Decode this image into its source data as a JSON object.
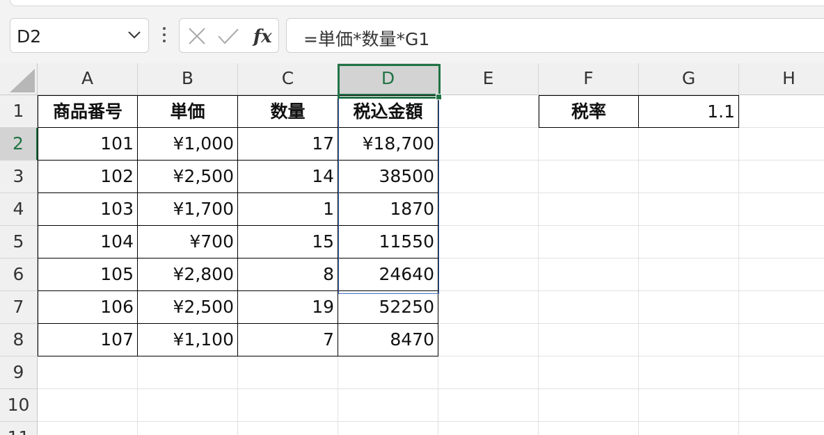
{
  "name_box": {
    "value": "D2"
  },
  "formula_bar": {
    "value": "=単価*数量*G1"
  },
  "icons": [
    "chevron-down-icon",
    "more-options-icon",
    "cancel-icon",
    "enter-icon",
    "insert-function-icon"
  ],
  "column_headers": [
    "A",
    "B",
    "C",
    "D",
    "E",
    "F",
    "G",
    "H"
  ],
  "row_headers": [
    "1",
    "2",
    "3",
    "4",
    "5",
    "6",
    "7",
    "8",
    "9",
    "10",
    "11"
  ],
  "selected_cell": {
    "column": "D",
    "row": "2"
  },
  "accent_color": "#217346",
  "range_color": "#4472c4",
  "table": {
    "headers": [
      "商品番号",
      "単価",
      "数量",
      "税込金額"
    ],
    "rows": [
      [
        "101",
        "¥1,000",
        "17",
        "¥18,700"
      ],
      [
        "102",
        "¥2,500",
        "14",
        "38500"
      ],
      [
        "103",
        "¥1,700",
        "1",
        "1870"
      ],
      [
        "104",
        "¥700",
        "15",
        "11550"
      ],
      [
        "105",
        "¥2,800",
        "8",
        "24640"
      ],
      [
        "106",
        "¥2,500",
        "19",
        "52250"
      ],
      [
        "107",
        "¥1,100",
        "7",
        "8470"
      ]
    ]
  },
  "tax_rate": {
    "label": "税率",
    "value": "1.1"
  }
}
